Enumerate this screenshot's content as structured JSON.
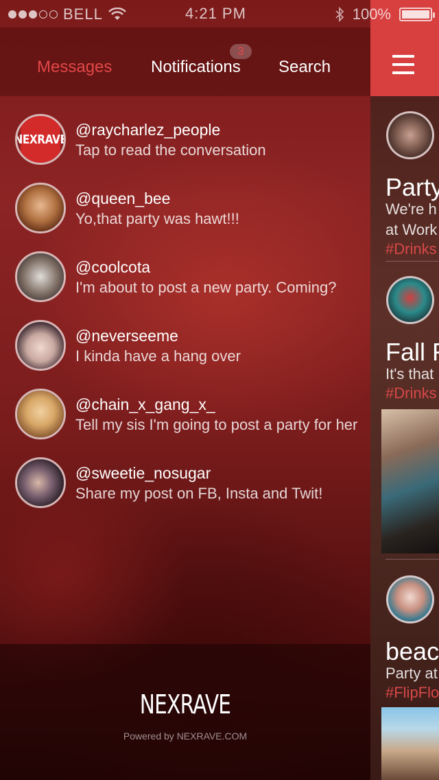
{
  "status_bar": {
    "carrier": "BELL",
    "time": "4:21 PM",
    "battery": "100%"
  },
  "tabs": {
    "messages": "Messages",
    "notifications": "Notifications",
    "notifications_badge": "3",
    "search": "Search"
  },
  "conversations": [
    {
      "handle": "@raycharlez_people",
      "preview": "Tap to read the conversation",
      "avatar_text": "NEXRAVE"
    },
    {
      "handle": "@queen_bee",
      "preview": "Yo,that party was hawt!!!"
    },
    {
      "handle": "@coolcota",
      "preview": "I'm about to post a new party. Coming?"
    },
    {
      "handle": "@neverseeme",
      "preview": "I kinda have a hang over"
    },
    {
      "handle": "@chain_x_gang_x_",
      "preview": "Tell my sis I'm going to post a party for her"
    },
    {
      "handle": "@sweetie_nosugar",
      "preview": "Share my post on FB, Insta and Twit!"
    }
  ],
  "footer": {
    "logo": "NEXRAVE",
    "powered": "Powered by NEXRAVE.COM"
  },
  "feed": {
    "posts": [
      {
        "title": "Party",
        "line1": "We're h",
        "line2": "at Work",
        "tag": "#Drinks"
      },
      {
        "title": "Fall F",
        "line1": "It's that",
        "tag": "#Drinks"
      },
      {
        "title": "beac",
        "line1": "Party at",
        "tag": "#FlipFlo"
      }
    ]
  },
  "colors": {
    "accent": "#d84040",
    "active_tab": "#e24848"
  }
}
